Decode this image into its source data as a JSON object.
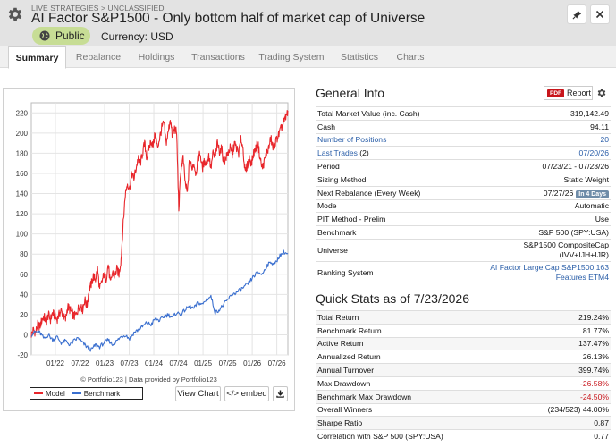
{
  "header": {
    "breadcrumb": "LIVE STRATEGIES > UNCLASSIFIED",
    "title": "AI Factor S&P1500 - Only bottom half of market cap of Universe",
    "visibility": "Public",
    "currency": "Currency: USD"
  },
  "tabs": [
    "Summary",
    "Rebalance",
    "Holdings",
    "Transactions",
    "Trading System",
    "Statistics",
    "Charts"
  ],
  "chart": {
    "footer": "© Portfolio123 | Data provided by Portfolio123",
    "view_chart": "View Chart",
    "embed": "</> embed",
    "download_icon": "download-icon"
  },
  "chart_data": {
    "type": "line",
    "x_tick_labels": [
      "01/22",
      "07/22",
      "01/23",
      "07/23",
      "01/24",
      "07/24",
      "01/25",
      "07/25",
      "01/26",
      "07/26"
    ],
    "y_tick_labels": [
      "-20",
      "0",
      "20",
      "40",
      "60",
      "80",
      "100",
      "120",
      "140",
      "160",
      "180",
      "200",
      "220"
    ],
    "ylim": [
      -20,
      230
    ],
    "grid": true,
    "legend": "bottom-left",
    "series": [
      {
        "name": "Model",
        "color": "#e8262b",
        "x": [
          0,
          0.5,
          1,
          1.5,
          2,
          2.5,
          3,
          3.5,
          4,
          4.5,
          5,
          5.5,
          6,
          6.5,
          7,
          7.5,
          8,
          8.5,
          9,
          9.5,
          10,
          10.5,
          11,
          11.5,
          12,
          12.5,
          13,
          13.5,
          14,
          14.5,
          15,
          15.5,
          16,
          16.5,
          17,
          17.5,
          18,
          18.5,
          19,
          19.5,
          20,
          20.5,
          21,
          21.5,
          22,
          22.5,
          23,
          23.5,
          24,
          24.5,
          25,
          25.5,
          26,
          26.5,
          27,
          27.5,
          28,
          28.5,
          29,
          29.5,
          30,
          30.5,
          31,
          31.5,
          32,
          32.5,
          33,
          33.5,
          34,
          34.5,
          35,
          35.5,
          36,
          36.5,
          37,
          37.5,
          38,
          38.5,
          39,
          39.5,
          40,
          40.5,
          41,
          41.5,
          42,
          42.5,
          43,
          43.5,
          44,
          44.5,
          45,
          45.5,
          46,
          46.5,
          47,
          47.5,
          48,
          48.5,
          49,
          49.5,
          50,
          50.5,
          51,
          51.5,
          52,
          52.5,
          53,
          53.5,
          54,
          54.5,
          55,
          55.5,
          56,
          56.5,
          57,
          57.5,
          58,
          58.5,
          59,
          59.5,
          60
        ],
        "y": [
          0,
          5,
          2,
          10,
          8,
          15,
          18,
          12,
          20,
          15,
          22,
          18,
          15,
          20,
          24,
          18,
          15,
          28,
          25,
          22,
          18,
          20,
          26,
          30,
          25,
          35,
          28,
          45,
          50,
          58,
          55,
          65,
          45,
          52,
          60,
          55,
          70,
          50,
          62,
          58,
          65,
          60,
          75,
          110,
          140,
          150,
          145,
          160,
          155,
          165,
          175,
          170,
          180,
          190,
          175,
          185,
          192,
          188,
          200,
          185,
          195,
          205,
          210,
          190,
          200,
          215,
          195,
          205,
          200,
          125,
          165,
          175,
          150,
          140,
          175,
          165,
          170,
          160,
          175,
          180,
          165,
          172,
          170,
          178,
          165,
          180,
          175,
          190,
          182,
          185,
          170,
          175,
          180,
          185,
          178,
          190,
          185,
          180,
          195,
          185,
          160,
          168,
          175,
          170,
          180,
          185,
          190,
          175,
          165,
          172,
          180,
          185,
          195,
          185,
          190,
          195,
          200,
          205,
          210,
          215,
          222
        ]
      },
      {
        "name": "Benchmark",
        "color": "#3a6fcf",
        "x": [
          0,
          1,
          2,
          3,
          4,
          5,
          6,
          7,
          8,
          9,
          10,
          11,
          12,
          13,
          14,
          15,
          16,
          17,
          18,
          19,
          20,
          21,
          22,
          23,
          24,
          25,
          26,
          27,
          28,
          29,
          30,
          31,
          32,
          33,
          34,
          35,
          36,
          37,
          38,
          39,
          40,
          41,
          42,
          43,
          44,
          45,
          46,
          47,
          48,
          49,
          50,
          51,
          52,
          53,
          54,
          55,
          56,
          57,
          58,
          59,
          60
        ],
        "y": [
          0,
          3,
          2,
          -4,
          0,
          -5,
          -2,
          -8,
          -6,
          -10,
          -6,
          -3,
          -8,
          -12,
          -15,
          -10,
          -12,
          -8,
          -5,
          -10,
          -6,
          -2,
          0,
          -4,
          2,
          5,
          8,
          12,
          10,
          16,
          14,
          18,
          20,
          17,
          22,
          20,
          25,
          28,
          26,
          32,
          30,
          35,
          38,
          22,
          25,
          30,
          35,
          40,
          42,
          45,
          48,
          52,
          58,
          62,
          60,
          68,
          72,
          70,
          78,
          82,
          80
        ]
      }
    ]
  },
  "general_info": {
    "title": "General Info",
    "report_label": "Report",
    "pdf_label": "PDF",
    "rows": [
      {
        "k": "Total Market Value (inc. Cash)",
        "v": "319,142.49"
      },
      {
        "k": "Cash",
        "v": "94.11"
      },
      {
        "k": "Number of Positions",
        "v": "20"
      },
      {
        "k": "Last Trades",
        "k2": " (2)",
        "v": "07/20/26"
      },
      {
        "k": "Period",
        "v": "07/23/21 - 07/23/26"
      },
      {
        "k": "Sizing Method",
        "v": "Static Weight"
      },
      {
        "k": "Next Rebalance (Every Week)",
        "v": "07/27/26",
        "badge": "In 4 Days"
      },
      {
        "k": "Mode",
        "v": "Automatic"
      },
      {
        "k": "PIT Method - Prelim",
        "v": "Use"
      },
      {
        "k": "Benchmark",
        "v": "S&P 500 (SPY:USA)"
      },
      {
        "k": "Universe",
        "v": "S&P1500 CompositeCap",
        "v2": "(IVV+IJH+IJR)"
      },
      {
        "k": "Ranking System",
        "v": "AI Factor Large Cap S&P1500 163",
        "v2": "Features ETM4"
      }
    ]
  },
  "quick_stats": {
    "title": "Quick Stats as of 7/23/2026",
    "rows": [
      {
        "k": "Total Return",
        "v": "219.24%"
      },
      {
        "k": "Benchmark Return",
        "v": "81.77%"
      },
      {
        "k": "Active Return",
        "v": "137.47%"
      },
      {
        "k": "Annualized Return",
        "v": "26.13%"
      },
      {
        "k": "Annual Turnover",
        "v": "399.74%"
      },
      {
        "k": "Max Drawdown",
        "v": "-26.58%"
      },
      {
        "k": "Benchmark Max Drawdown",
        "v": "-24.50%"
      },
      {
        "k": "Overall Winners",
        "v": "(234/523) 44.00%"
      },
      {
        "k": "Sharpe Ratio",
        "v": "0.87"
      },
      {
        "k": "Correlation with S&P 500 (SPY:USA)",
        "v": "0.77"
      }
    ]
  }
}
